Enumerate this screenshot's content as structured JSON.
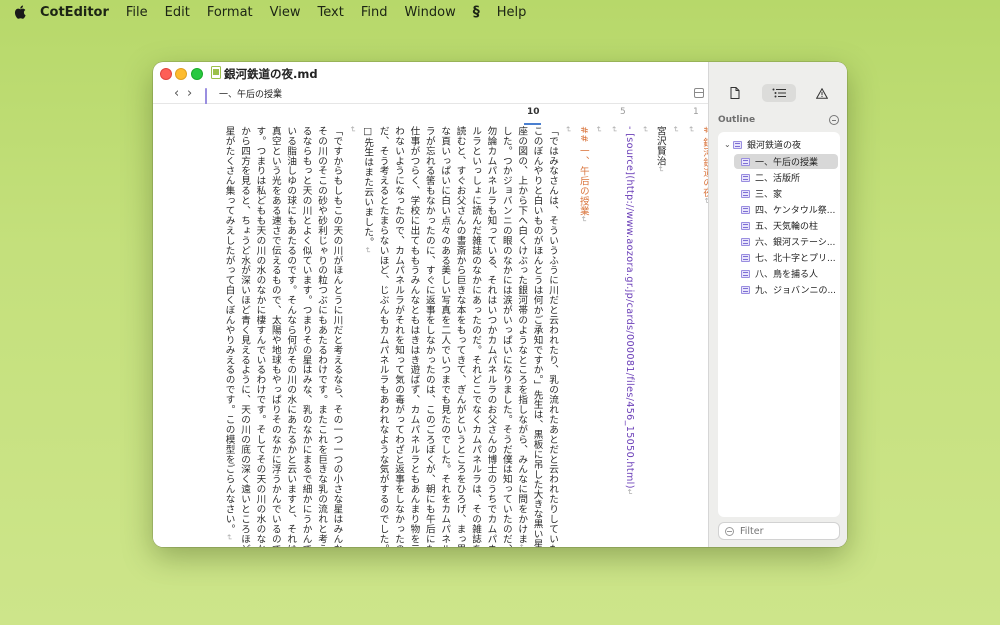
{
  "menubar": {
    "app_name": "CotEditor",
    "items": [
      "File",
      "Edit",
      "Format",
      "View",
      "Text",
      "Find",
      "Window",
      "Help"
    ],
    "script_icon": "script-icon"
  },
  "window": {
    "title": "銀河鉄道の夜.md",
    "navbar": {
      "current_item": "一、午后の授業"
    }
  },
  "ruler": {
    "labels": [
      "10",
      "5",
      "1"
    ]
  },
  "editor": {
    "lines": [
      {
        "text": "# 銀河鉄道の夜",
        "kind": "heading"
      },
      {
        "text": "",
        "kind": "blank"
      },
      {
        "text": "",
        "kind": "blank"
      },
      {
        "text": "宮沢賢治",
        "kind": "normal"
      },
      {
        "text": "",
        "kind": "blank"
      },
      {
        "text": "- [source](http://www.aozora.gr.jp/cards/000081/files/456_15050.html)",
        "kind": "link"
      },
      {
        "text": "",
        "kind": "blank"
      },
      {
        "text": "",
        "kind": "blank"
      },
      {
        "text": "## 一、午后の授業",
        "kind": "heading"
      },
      {
        "text": "",
        "kind": "blank"
      },
      {
        "text": "「ではみなさんは、そういうふうに川だと云われたり、乳の流れたあとだと云われたりしていた",
        "kind": "normal"
      },
      {
        "text": "このぼんやりと白いものがほんとうは何かご承知ですか。」先生は、黒板に吊した大きな黒い星",
        "kind": "normal"
      },
      {
        "text": "座の図の、上から下へ白くけぶった銀河帯のようなところを指しながら、みんなに問をかけま",
        "kind": "normal"
      },
      {
        "text": "した。つかジョバンニの眼のなかには涙がいっぱいになりました。そうだ僕は知っていたのだ、",
        "kind": "normal"
      },
      {
        "text": "勿論カムパネルラも知っている、それはいつかカムパネルラのお父さんの博士のうちでカムパネ",
        "kind": "normal"
      },
      {
        "text": "ルラといっしょに読んだ雑誌のなかにあったのだ。それどこでなくカムパネルラは、その雑誌を",
        "kind": "normal"
      },
      {
        "text": "読むと、すぐお父さんの書斎から巨きな本をもってきて、ぎんがというところをひろげ、まっ黒",
        "kind": "normal"
      },
      {
        "text": "な頁いっぱいに白い点々のある美しい写真を二人でいつまでも見たのでした。それをカムパネル",
        "kind": "normal"
      },
      {
        "text": "ラが忘れる筈もなかったのに、すぐに返事をしなかったのは、このごろぼくが、朝にも午后にも",
        "kind": "normal"
      },
      {
        "text": "仕事がつらく、学校に出てももうみんなともはきはき遊ばず、カムパネルラともあんまり物を云",
        "kind": "normal"
      },
      {
        "text": "わないようになったので、カムパネルラがそれを知って気の毒がってわざと返事をしなかったの",
        "kind": "normal"
      },
      {
        "text": "だ、そう考えるとたまらないほど、じぶんもカムパネルラもあわれなような気がするのでした。",
        "kind": "normal"
      },
      {
        "text": "□先生はまた云いました。",
        "kind": "normal"
      },
      {
        "text": "",
        "kind": "blank"
      },
      {
        "text": "「ですからもしもこの天の川がほんとうに川だと考えるなら、その一つ一つの小さな星はみんな",
        "kind": "normal"
      },
      {
        "text": "その川のそこの砂や砂利じゃりの粒つぶにもあたるわけです。またこれを巨きな乳の流れと考え",
        "kind": "normal"
      },
      {
        "text": "るならもっと天の川とよく似ています。つまりその星はみな、乳のなかにまるで細かにうかんで",
        "kind": "normal"
      },
      {
        "text": "いる脂油しゆの球にもあたるのです。そんなら何がその川の水にあたるかと云いますと、それは",
        "kind": "normal"
      },
      {
        "text": "真空という光をある速さで伝えるもので、太陽や地球もやっぱりそのなかに浮うかんでいるので",
        "kind": "normal"
      },
      {
        "text": "す。つまりは私どもも天の川の水のなかに棲すんでいるわけです。そしてその天の川の水のなか",
        "kind": "normal"
      },
      {
        "text": "から四方を見ると、ちょうど水が深いほど青く見えるように、天の川の底の深く遠いところほど",
        "kind": "normal"
      },
      {
        "text": "星がたくさん集ってみえしたがって白くぼんやりみえるのです。この模型をごらんなさい。",
        "kind": "normal"
      }
    ]
  },
  "inspector": {
    "tabs": [
      "document-icon",
      "outline-icon",
      "warning-icon"
    ],
    "outline_title": "Outline",
    "outline": {
      "root": "銀河鉄道の夜",
      "items": [
        "一、午后の授業",
        "二、活版所",
        "三、家",
        "四、ケンタウル祭...",
        "五、天気輪の柱",
        "六、銀河ステーシ...",
        "七、北十字とプリ...",
        "八、鳥を捕る人",
        "九、ジョバンニの..."
      ],
      "selected_index": 0
    },
    "filter_placeholder": "Filter"
  }
}
